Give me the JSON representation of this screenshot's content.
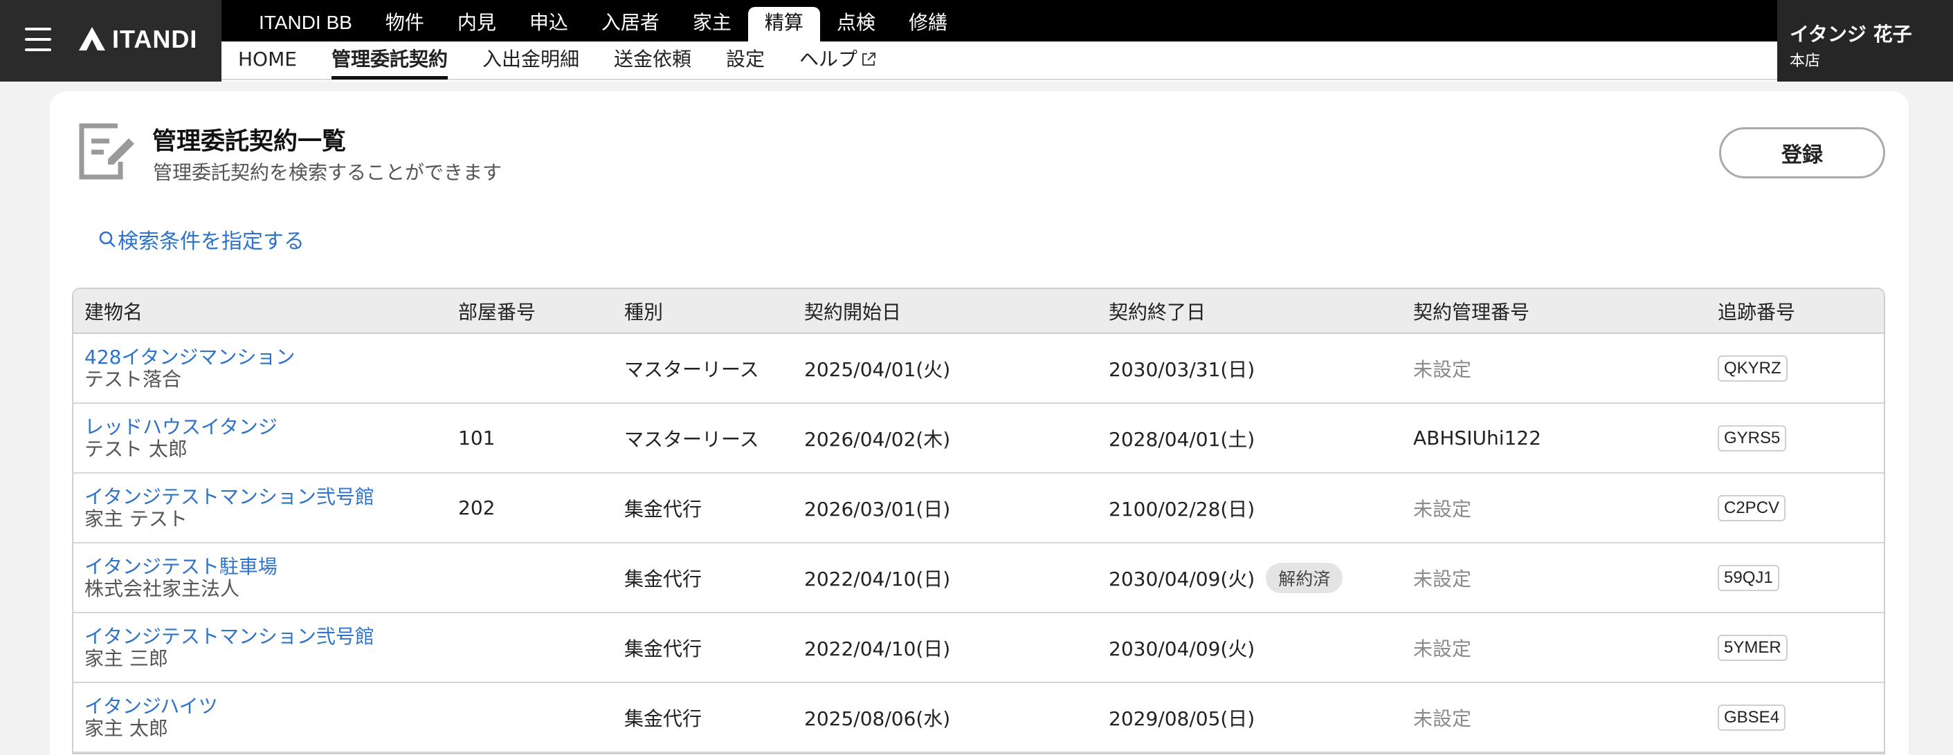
{
  "header": {
    "logo_text": "ITANDI",
    "top_nav": [
      {
        "label": "ITANDI BB",
        "active": false
      },
      {
        "label": "物件",
        "active": false
      },
      {
        "label": "内見",
        "active": false
      },
      {
        "label": "申込",
        "active": false
      },
      {
        "label": "入居者",
        "active": false
      },
      {
        "label": "家主",
        "active": false
      },
      {
        "label": "精算",
        "active": true
      },
      {
        "label": "点検",
        "active": false
      },
      {
        "label": "修繕",
        "active": false
      }
    ],
    "sub_nav": [
      {
        "label": "HOME",
        "active": false
      },
      {
        "label": "管理委託契約",
        "active": true
      },
      {
        "label": "入出金明細",
        "active": false
      },
      {
        "label": "送金依頼",
        "active": false
      },
      {
        "label": "設定",
        "active": false
      },
      {
        "label": "ヘルプ",
        "active": false
      }
    ],
    "user": {
      "name": "イタンジ 花子",
      "branch": "本店"
    }
  },
  "page": {
    "title": "管理委託契約一覧",
    "subtitle": "管理委託契約を検索することができます",
    "register_label": "登録",
    "search_link": "検索条件を指定する"
  },
  "table": {
    "columns": [
      "建物名",
      "部屋番号",
      "種別",
      "契約開始日",
      "契約終了日",
      "契約管理番号",
      "追跡番号"
    ],
    "rows": [
      {
        "building": "428イタンジマンション",
        "owner": "テスト落合",
        "room": "",
        "type": "マスターリース",
        "start": "2025/04/01(火)",
        "end": "2030/03/31(日)",
        "badge": "",
        "contract_no": "未設定",
        "tracking": "QKYRZ"
      },
      {
        "building": "レッドハウスイタンジ",
        "owner": "テスト 太郎",
        "room": "101",
        "type": "マスターリース",
        "start": "2026/04/02(木)",
        "end": "2028/04/01(土)",
        "badge": "",
        "contract_no": "ABHSIUhi122",
        "tracking": "GYRS5"
      },
      {
        "building": "イタンジテストマンション弐号館",
        "owner": "家主 テスト",
        "room": "202",
        "type": "集金代行",
        "start": "2026/03/01(日)",
        "end": "2100/02/28(日)",
        "badge": "",
        "contract_no": "未設定",
        "tracking": "C2PCV"
      },
      {
        "building": "イタンジテスト駐車場",
        "owner": "株式会社家主法人",
        "room": "",
        "type": "集金代行",
        "start": "2022/04/10(日)",
        "end": "2030/04/09(火)",
        "badge": "解約済",
        "contract_no": "未設定",
        "tracking": "59QJ1"
      },
      {
        "building": "イタンジテストマンション弐号館",
        "owner": "家主 三郎",
        "room": "",
        "type": "集金代行",
        "start": "2022/04/10(日)",
        "end": "2030/04/09(火)",
        "badge": "",
        "contract_no": "未設定",
        "tracking": "5YMER"
      },
      {
        "building": "イタンジハイツ",
        "owner": "家主 太郎",
        "room": "",
        "type": "集金代行",
        "start": "2025/08/06(水)",
        "end": "2029/08/05(日)",
        "badge": "",
        "contract_no": "未設定",
        "tracking": "GBSE4"
      }
    ]
  },
  "colors": {
    "header_dark": "#262626",
    "link_blue": "#2e73c7",
    "muted_text": "#8a8a8a"
  }
}
